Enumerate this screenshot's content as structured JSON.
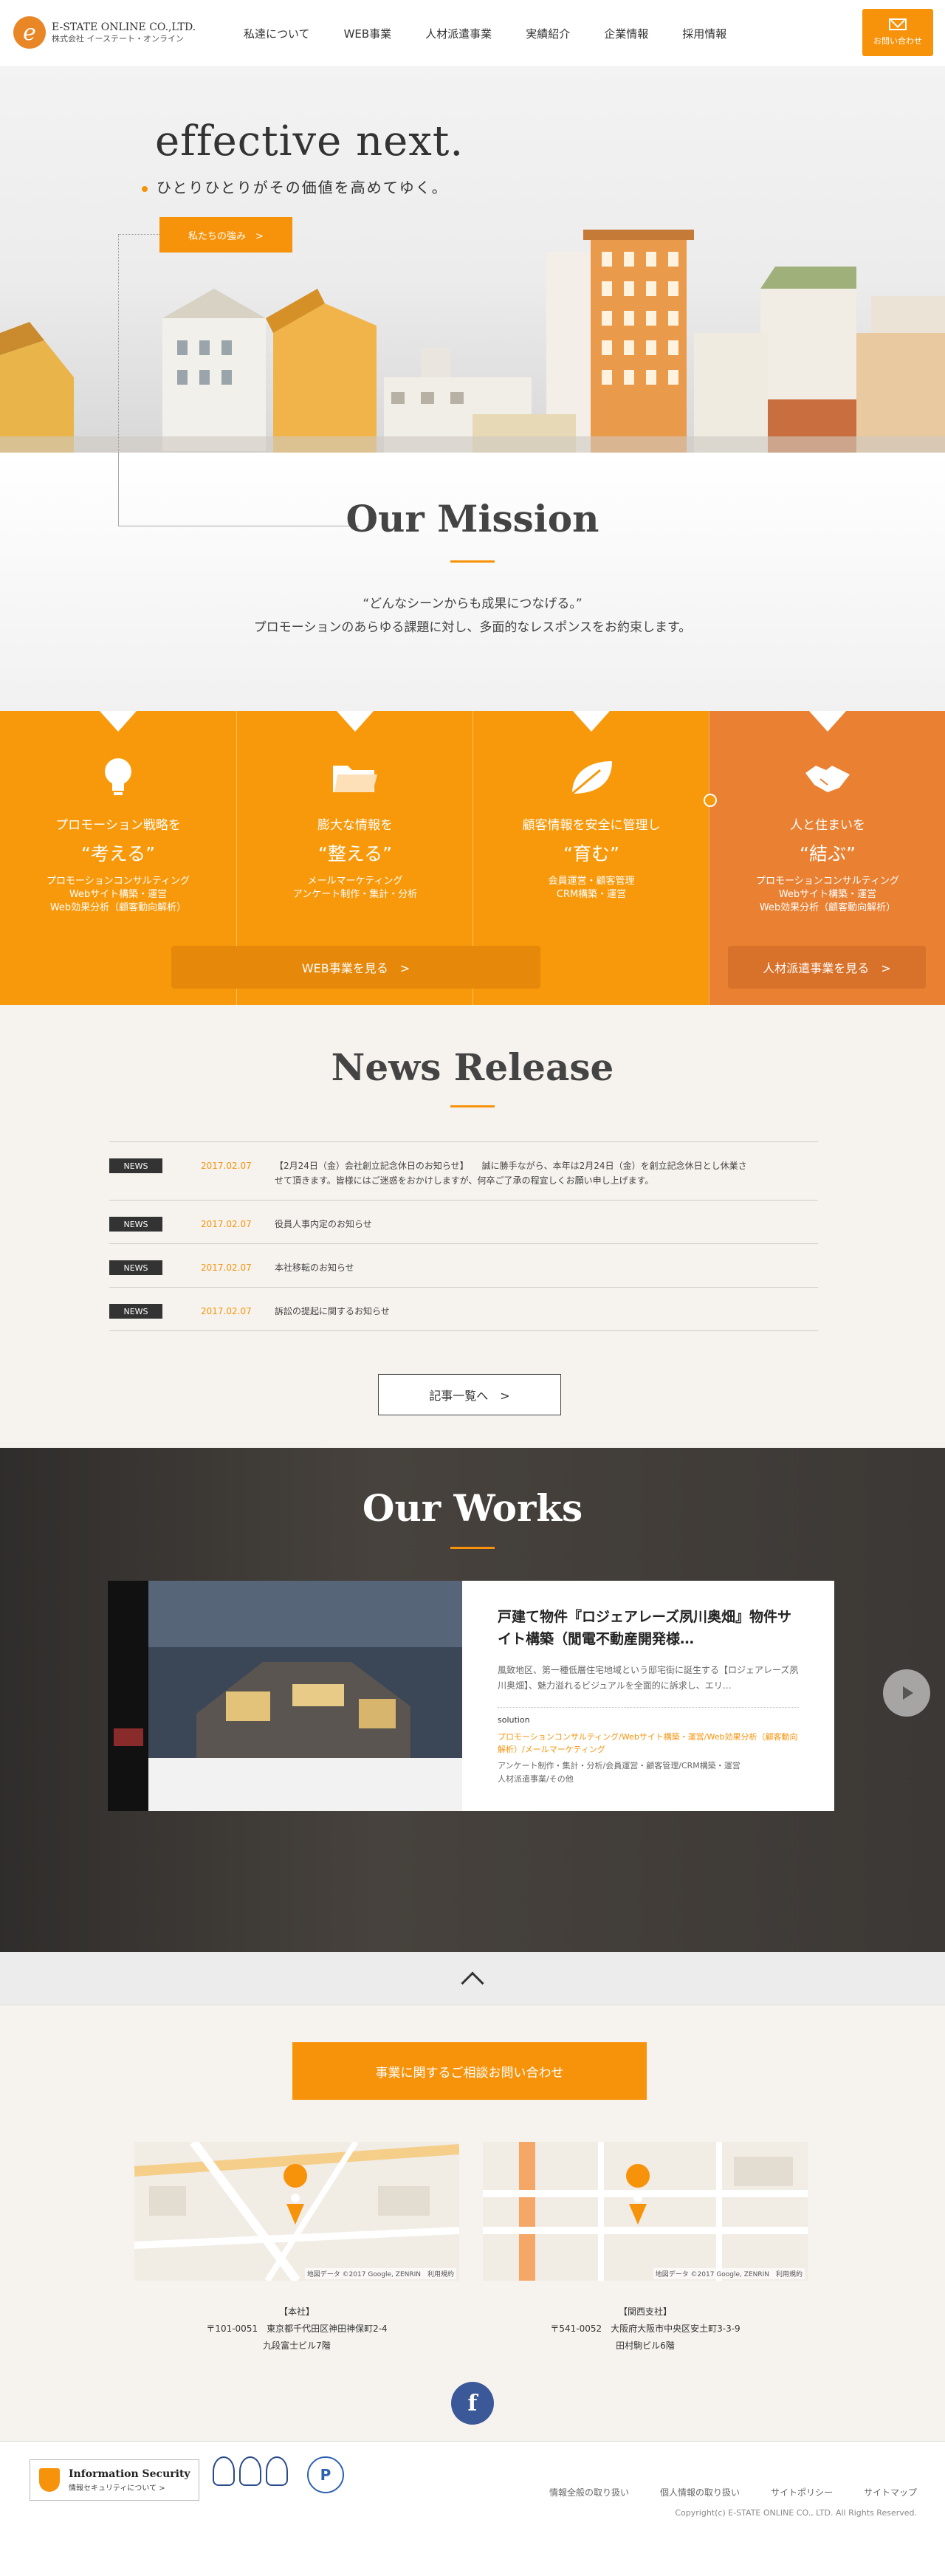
{
  "header": {
    "logo_en": "E-STATE ONLINE CO.,LTD.",
    "logo_jp": "株式会社 イーステート・オンライン",
    "nav": [
      "私達について",
      "WEB事業",
      "人材派遣事業",
      "実績紹介",
      "企業情報",
      "採用情報"
    ],
    "contact_label": "お問い合わせ"
  },
  "hero": {
    "title": "effective next.",
    "subtitle": "ひとりひとりがその価値を高めてゆく。",
    "button_label": "私たちの強み　>"
  },
  "mission": {
    "title": "Our Mission",
    "quote": "“どんなシーンからも成果につなげる。”",
    "description": "プロモーションのあらゆる課題に対し、多面的なレスポンスをお約束します。"
  },
  "services": [
    {
      "icon": "lightbulb-icon",
      "title": "プロモーション戦略を",
      "keyword": "“考える”",
      "details": [
        "プロモーションコンサルティング",
        "Webサイト構築・運営",
        "Web効果分析（顧客動向解析）"
      ]
    },
    {
      "icon": "folder-icon",
      "title": "膨大な情報を",
      "keyword": "“整える”",
      "details": [
        "メールマーケティング",
        "アンケート制作・集計・分析"
      ]
    },
    {
      "icon": "leaf-icon",
      "title": "顧客情報を安全に管理し",
      "keyword": "“育む”",
      "details": [
        "会員運営・顧客管理",
        "CRM構築・運営"
      ]
    },
    {
      "icon": "handshake-icon",
      "title": "人と住まいを",
      "keyword": "“結ぶ”",
      "details": [
        "プロモーションコンサルティング",
        "Webサイト構築・運営",
        "Web効果分析（顧客動向解析）"
      ]
    }
  ],
  "service_buttons": {
    "web": "WEB事業を見る　>",
    "staffing": "人材派遣事業を見る　>"
  },
  "news": {
    "title": "News Release",
    "items": [
      {
        "badge": "NEWS",
        "date": "2017.02.07",
        "text": "【2月24日（金）会社創立記念休日のお知らせ】　　誠に勝手ながら、本年は2月24日（金）を創立記念休日とし休業させて頂きます。皆様にはご迷惑をおかけしますが、何卒ご了承の程宜しくお願い申し上げます。"
      },
      {
        "badge": "NEWS",
        "date": "2017.02.07",
        "text": "役員人事内定のお知らせ"
      },
      {
        "badge": "NEWS",
        "date": "2017.02.07",
        "text": "本社移転のお知らせ"
      },
      {
        "badge": "NEWS",
        "date": "2017.02.07",
        "text": "訴訟の提起に関するお知らせ"
      }
    ],
    "more_label": "記事一覧へ　>"
  },
  "works": {
    "title": "Our Works",
    "card_title": "戸建て物件『ロジェアレーズ夙川奥畑』物件サイト構築（閒電不動産開発様…",
    "card_text": "風致地区、第一種低層住宅地域という邸宅街に誕生する【ロジェアレーズ夙川奥畑】、魅力溢れるビジュアルを全面的に訴求し、エリ…",
    "solution_label": "solution",
    "solution_main": "プロモーションコンサルティング/Webサイト構築・運営/Web効果分析（顧客動向解析）/メールマーケティング",
    "solution_sub": "アンケート制作・集計・分析/会員運営・顧客管理/CRM構築・運営\n人材派遣事業/その他"
  },
  "access": {
    "consult_label": "事業に関するご相談お問い合わせ",
    "map_credit": "地図データ ©2017 Google, ZENRIN　利用規約",
    "offices": [
      {
        "name": "【本社】",
        "line1": "〒101-0051　東京都千代田区神田神保町2-4",
        "line2": "九段富士ビル7階"
      },
      {
        "name": "【関西支社】",
        "line1": "〒541-0052　大阪府大阪市中央区安土町3-3-9",
        "line2": "田村駒ビル6階"
      }
    ]
  },
  "footer": {
    "security_title": "Information Security",
    "security_sub": "情報セキュリティについて >",
    "links": [
      "情報全般の取り扱い",
      "個人情報の取り扱い",
      "サイトポリシー",
      "サイトマップ"
    ],
    "copyright": "Copyright(c) E-STATE ONLINE CO., LTD. All Rights Reserved."
  },
  "colors": {
    "accent": "#f7930b",
    "accent_dark": "#e98032",
    "facebook": "#3b5998"
  }
}
